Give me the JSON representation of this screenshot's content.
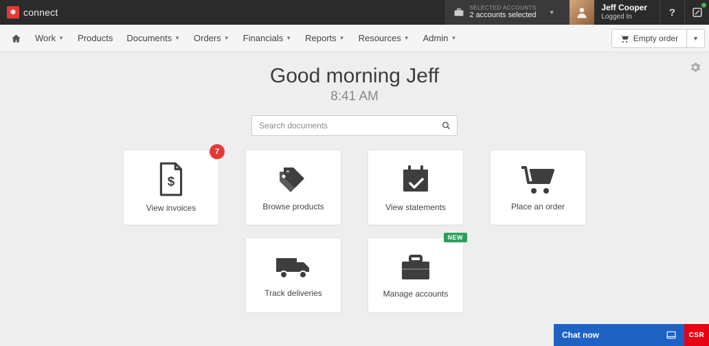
{
  "brand": {
    "name": "connect"
  },
  "account_selector": {
    "label": "SELECTED ACCOUNTS",
    "value": "2 accounts selected"
  },
  "user": {
    "name": "Jeff Cooper",
    "status": "Logged In"
  },
  "nav": {
    "items": [
      {
        "label": "Work",
        "dropdown": true
      },
      {
        "label": "Products",
        "dropdown": false
      },
      {
        "label": "Documents",
        "dropdown": true
      },
      {
        "label": "Orders",
        "dropdown": true
      },
      {
        "label": "Financials",
        "dropdown": true
      },
      {
        "label": "Reports",
        "dropdown": true
      },
      {
        "label": "Resources",
        "dropdown": true
      },
      {
        "label": "Admin",
        "dropdown": true
      }
    ],
    "empty_order_label": "Empty order"
  },
  "greeting": "Good morning Jeff",
  "time": "8:41 AM",
  "search": {
    "placeholder": "Search documents"
  },
  "tiles": [
    {
      "label": "View invoices",
      "icon": "invoice",
      "badge_count": "7"
    },
    {
      "label": "Browse products",
      "icon": "tags"
    },
    {
      "label": "View statements",
      "icon": "calendar-check"
    },
    {
      "label": "Place an order",
      "icon": "cart"
    },
    {
      "label": "Track deliveries",
      "icon": "truck"
    },
    {
      "label": "Manage accounts",
      "icon": "briefcase",
      "badge_new": "NEW"
    }
  ],
  "chat": {
    "label": "Chat now"
  },
  "corner": {
    "label": "CSR"
  }
}
